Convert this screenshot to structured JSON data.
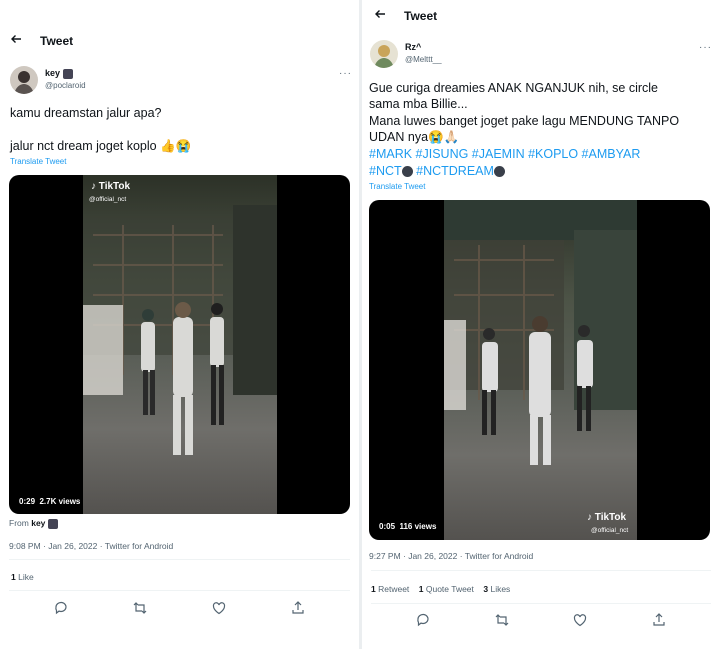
{
  "left": {
    "header_title": "Tweet",
    "user_name": "key",
    "user_handle": "@poclaroid",
    "text_line1": "kamu dreamstan jalur apa?",
    "text_line2": "jalur nct dream joget koplo",
    "text_emoji": "👍😭",
    "translate": "Translate Tweet",
    "video": {
      "time": "0:29",
      "views": "2.7K views",
      "tiktok": "TikTok",
      "tiktok_handle": "@official_nct"
    },
    "from_label": "From",
    "from_name": "key",
    "timestamp": "9:08 PM · Jan 26, 2022 · Twitter for Android",
    "likes_count": "1",
    "likes_label": "Like"
  },
  "right": {
    "header_title": "Tweet",
    "user_name": "Rz^",
    "user_handle": "@Melttt__",
    "text_line1": "Gue curiga dreamies ANAK NGANJUK nih, se circle",
    "text_line2": "sama mba Billie...",
    "text_line3": "Mana luwes banget joget pake lagu MENDUNG TANPO",
    "text_line4": "UDAN nya",
    "text_line4_emoji": "😭🙏🏻",
    "hashtags_line1": "#MARK #JISUNG #JAEMIN #KOPLO #AMBYAR",
    "hashtag_nct": "#NCT",
    "hashtag_nctdream": "#NCTDREAM",
    "translate": "Translate Tweet",
    "video": {
      "time": "0:05",
      "views": "116 views",
      "tiktok": "TikTok",
      "tiktok_handle": "@official_nct"
    },
    "timestamp": "9:27 PM · Jan 26, 2022 · Twitter for Android",
    "retweet_count": "1",
    "retweet_label": "Retweet",
    "quote_count": "1",
    "quote_label": "Quote Tweet",
    "likes_count": "3",
    "likes_label": "Likes"
  },
  "icons": [
    "back-arrow-icon",
    "more-icon",
    "reply-icon",
    "retweet-icon",
    "like-icon",
    "share-icon",
    "tiktok-icon"
  ],
  "colors": {
    "link": "#1d9bf0",
    "secondary_text": "#536471",
    "divider": "#eff3f4"
  }
}
